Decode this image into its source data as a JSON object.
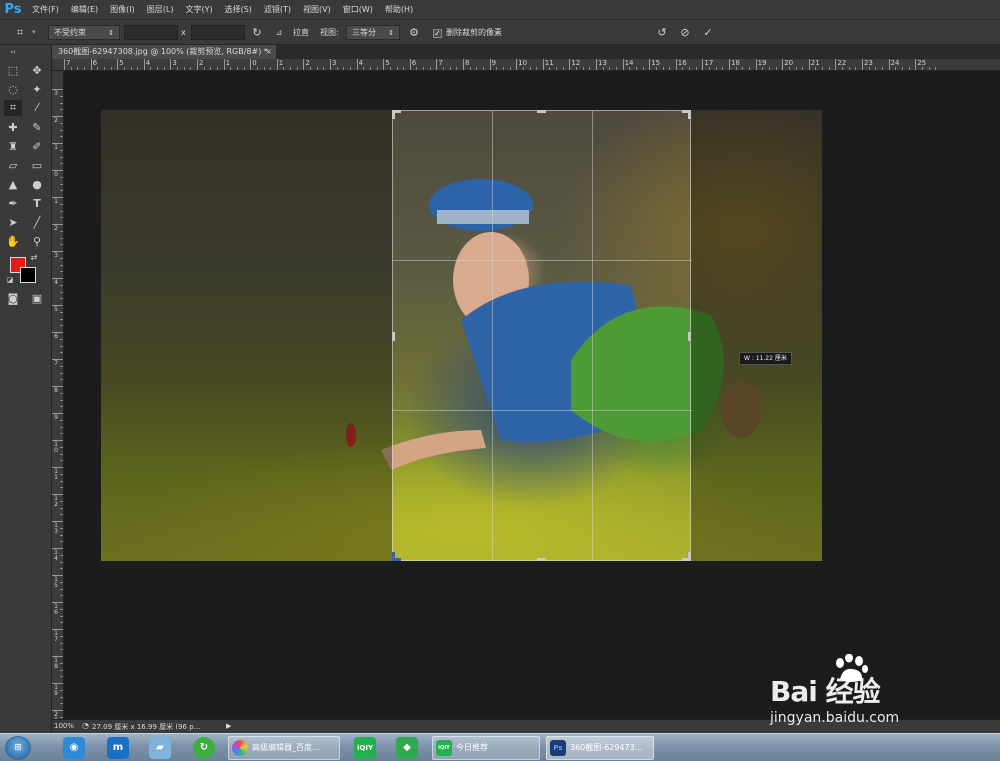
{
  "app": {
    "logo": "Ps"
  },
  "menu": [
    "文件(F)",
    "编辑(E)",
    "图像(I)",
    "图层(L)",
    "文字(Y)",
    "选择(S)",
    "滤镜(T)",
    "视图(V)",
    "窗口(W)",
    "帮助(H)"
  ],
  "options": {
    "ratio_select": "不受约束",
    "width_value": "",
    "x_sep": "x",
    "height_value": "",
    "straighten_label": "拉直",
    "view_label": "视图:",
    "view_select": "三等分",
    "delete_cropped_label": "删除裁剪的像素",
    "delete_cropped_checked": true
  },
  "document": {
    "tab_title": "360截图-62947308.jpg @ 100% (裁剪预览, RGB/8#) *",
    "close_glyph": "×"
  },
  "ruler_top_labels": [
    "7",
    "6",
    "5",
    "4",
    "3",
    "2",
    "1",
    "0",
    "1",
    "2",
    "3",
    "4",
    "5",
    "6",
    "7",
    "8",
    "9",
    "10",
    "11",
    "12",
    "13",
    "14",
    "15",
    "16",
    "17",
    "18",
    "19",
    "20",
    "21",
    "22",
    "23",
    "24",
    "25"
  ],
  "ruler_left_labels": [
    "3",
    "2",
    "1",
    "0",
    "1",
    "2",
    "3",
    "4",
    "5",
    "6",
    "7",
    "8",
    "9",
    "10",
    "11",
    "12",
    "13",
    "14",
    "15",
    "16",
    "17",
    "18",
    "19",
    "20"
  ],
  "crop": {
    "width_tooltip": "W : 11.22 厘米"
  },
  "status": {
    "zoom": "100%",
    "doc_info": "27.09 厘米 x 16.99 厘米 (96 p...",
    "arrow": "▶"
  },
  "taskbar": {
    "buttons": [
      {
        "label": "高级编辑器_百度...",
        "color": "#e04b7a"
      },
      {
        "label": "",
        "color": "#22b14c"
      },
      {
        "label": "",
        "color": "#2fa84f"
      },
      {
        "label": "今日推荐",
        "color": "#22b14c"
      },
      {
        "label": "360截图-629473...",
        "color": "#1e3a6e"
      }
    ],
    "iqiyi_glyph": "iQIY",
    "ps_glyph": "Ps"
  },
  "watermark": {
    "brand": "Bai  经验",
    "url": "jingyan.baidu.com"
  }
}
